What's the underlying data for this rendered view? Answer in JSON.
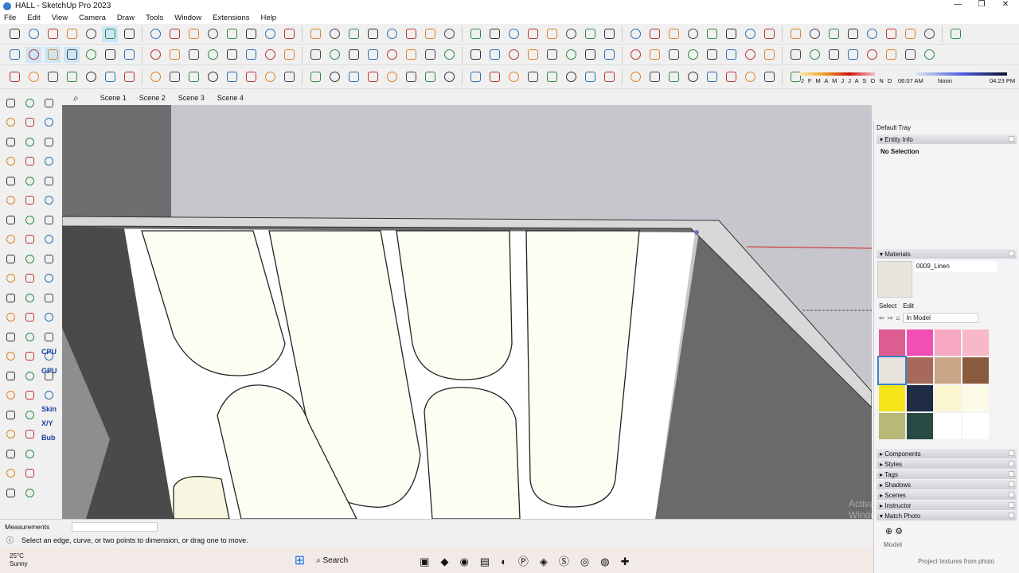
{
  "window": {
    "title": "HALL - SketchUp Pro 2023",
    "min": "—",
    "max": "❐",
    "close": "✕"
  },
  "menu": [
    "File",
    "Edit",
    "View",
    "Camera",
    "Draw",
    "Tools",
    "Window",
    "Extensions",
    "Help"
  ],
  "toolbar_icon_counts": [
    48,
    47,
    40
  ],
  "months": "J F M A M J J A S O N D",
  "time": {
    "start": "06:07 AM",
    "mid": "Noon",
    "end": "04:23 PM"
  },
  "scenes": [
    "Scene 1",
    "Scene 2",
    "Scene 3",
    "Scene 4"
  ],
  "left_labels": {
    "cpu": "CPU",
    "gpu": "GPU",
    "skin": "Skin",
    "xyz": "X/Y",
    "bub": "Bub"
  },
  "tray": {
    "title": "Default Tray",
    "entity_info": "Entity Info",
    "no_selection": "No Selection",
    "materials": "Materials",
    "material_name": "0009_Linen",
    "select_tab": "Select",
    "edit_tab": "Edit",
    "library": "In Model",
    "swatches": [
      "#dd5c92",
      "#f24fb4",
      "#f5a8c0",
      "#f8b8c8",
      "#e8e4dc",
      "#a76a5a",
      "#c8a584",
      "#8a5a3c",
      "#f7e51c",
      "#1f2a44",
      "#fbf6cf",
      "#fbfbe8",
      "#b8b878",
      "#284a44",
      "#ffffff",
      "#ffffff"
    ],
    "panels": [
      "Components",
      "Styles",
      "Tags",
      "Shadows",
      "Scenes",
      "Instructor"
    ],
    "match_photo": "Match Photo",
    "model_label": "Model",
    "project_btn": "Project textures from photo"
  },
  "measurements": {
    "label": "Measurements",
    "value": ""
  },
  "status": "Select an edge, curve, or two points to dimension, or drag one to move.",
  "weather": {
    "temp": "25°C",
    "desc": "Sunny"
  },
  "search": "Search",
  "watermark": "Activate Windows"
}
